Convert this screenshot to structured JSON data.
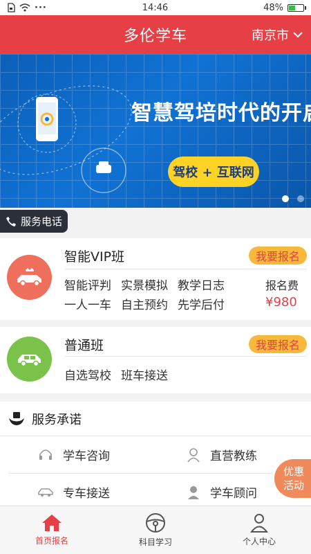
{
  "status": {
    "time": "14:46",
    "battery": "48%",
    "battery_level": 0.48
  },
  "header": {
    "title": "多伦学车",
    "city": "南京市"
  },
  "banner": {
    "headline": "智慧驾培时代的开启",
    "pill": "驾校 + 互联网",
    "slides": 2,
    "active_slide": 1
  },
  "service_phone": {
    "label": "服务电话"
  },
  "courses": [
    {
      "name": "智能VIP班",
      "enroll_label": "我要报名",
      "features": [
        "智能评判",
        "实景模拟",
        "教学日志",
        "一人一车",
        "自主预约",
        "先学后付"
      ],
      "fee_label": "报名费",
      "fee": "¥980",
      "color": "#ee6f5b"
    },
    {
      "name": "普通班",
      "enroll_label": "我要报名",
      "features": [
        "自选驾校",
        "班车接送"
      ],
      "color": "#7bc24a"
    }
  ],
  "promise": {
    "title": "服务承诺",
    "items": [
      {
        "label": "学车咨询",
        "icon": "headset-icon"
      },
      {
        "label": "直营教练",
        "icon": "coach-icon"
      },
      {
        "label": "专车接送",
        "icon": "car-icon"
      },
      {
        "label": "学车顾问",
        "icon": "advisor-icon"
      }
    ]
  },
  "promo": {
    "label": "优惠活动"
  },
  "tabs": [
    {
      "label": "首页报名",
      "icon": "home-icon",
      "active": true
    },
    {
      "label": "科目学习",
      "icon": "steering-wheel-icon",
      "active": false
    },
    {
      "label": "个人中心",
      "icon": "user-icon",
      "active": false
    }
  ],
  "colors": {
    "primary": "#e64046",
    "banner": "#0b5fb8",
    "accent_yellow": "#ffd226",
    "enroll_bg": "#f6b93b"
  }
}
